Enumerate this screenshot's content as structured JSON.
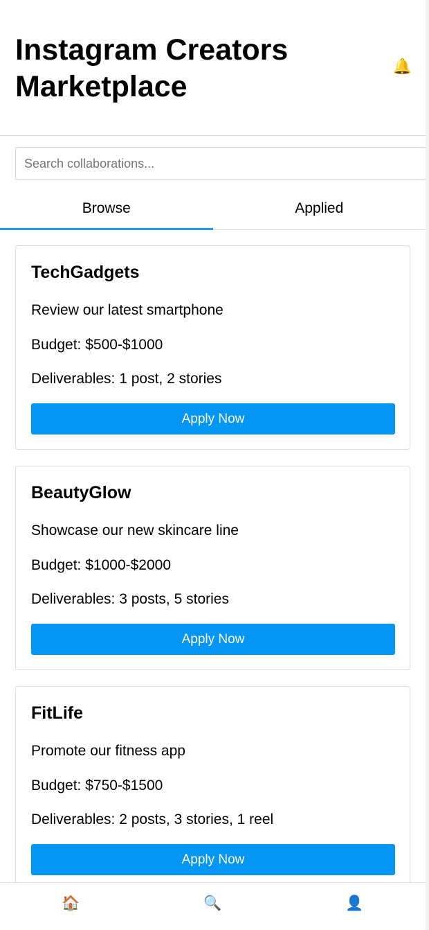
{
  "header": {
    "title": "Instagram Creators Marketplace",
    "notification_icon": "🔔"
  },
  "search": {
    "placeholder": "Search collaborations...",
    "value": ""
  },
  "tabs": [
    {
      "label": "Browse",
      "active": true
    },
    {
      "label": "Applied",
      "active": false
    }
  ],
  "listings": [
    {
      "brand": "TechGadgets",
      "description": "Review our latest smartphone",
      "budget": "Budget: $500-$1000",
      "deliverables": "Deliverables: 1 post, 2 stories",
      "button_label": "Apply Now"
    },
    {
      "brand": "BeautyGlow",
      "description": "Showcase our new skincare line",
      "budget": "Budget: $1000-$2000",
      "deliverables": "Deliverables: 3 posts, 5 stories",
      "button_label": "Apply Now"
    },
    {
      "brand": "FitLife",
      "description": "Promote our fitness app",
      "budget": "Budget: $750-$1500",
      "deliverables": "Deliverables: 2 posts, 3 stories, 1 reel",
      "button_label": "Apply Now"
    }
  ],
  "bottom_nav": [
    {
      "name": "home",
      "icon": "🏠"
    },
    {
      "name": "search",
      "icon": "🔍"
    },
    {
      "name": "profile",
      "icon": "👤"
    }
  ],
  "colors": {
    "accent": "#2196f3",
    "button": "#0595f3"
  }
}
